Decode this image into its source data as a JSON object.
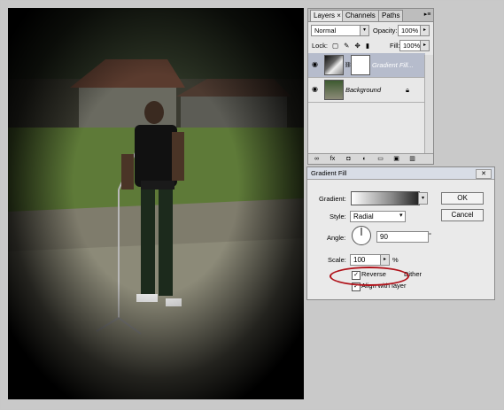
{
  "layers_panel": {
    "tabs": [
      {
        "label": "Layers ×"
      },
      {
        "label": "Channels"
      },
      {
        "label": "Paths"
      }
    ],
    "blend_mode": "Normal",
    "opacity_label": "Opacity:",
    "opacity_value": "100%",
    "lock_label": "Lock:",
    "fill_label": "Fill:",
    "fill_value": "100%",
    "layers": [
      {
        "name": "Gradient Fill..."
      },
      {
        "name": "Background"
      }
    ]
  },
  "dialog": {
    "title": "Gradient Fill",
    "gradient_label": "Gradient:",
    "style_label": "Style:",
    "style_value": "Radial",
    "angle_label": "Angle:",
    "angle_value": "90",
    "angle_unit": "°",
    "scale_label": "Scale:",
    "scale_value": "100",
    "scale_unit": "%",
    "reverse_label": "Reverse",
    "dither_label": "Dither",
    "align_label": "Align with layer",
    "ok_label": "OK",
    "cancel_label": "Cancel"
  },
  "colors": {
    "highlight_ellipse": "#b0121a",
    "selected_layer": "#b6bccc"
  }
}
